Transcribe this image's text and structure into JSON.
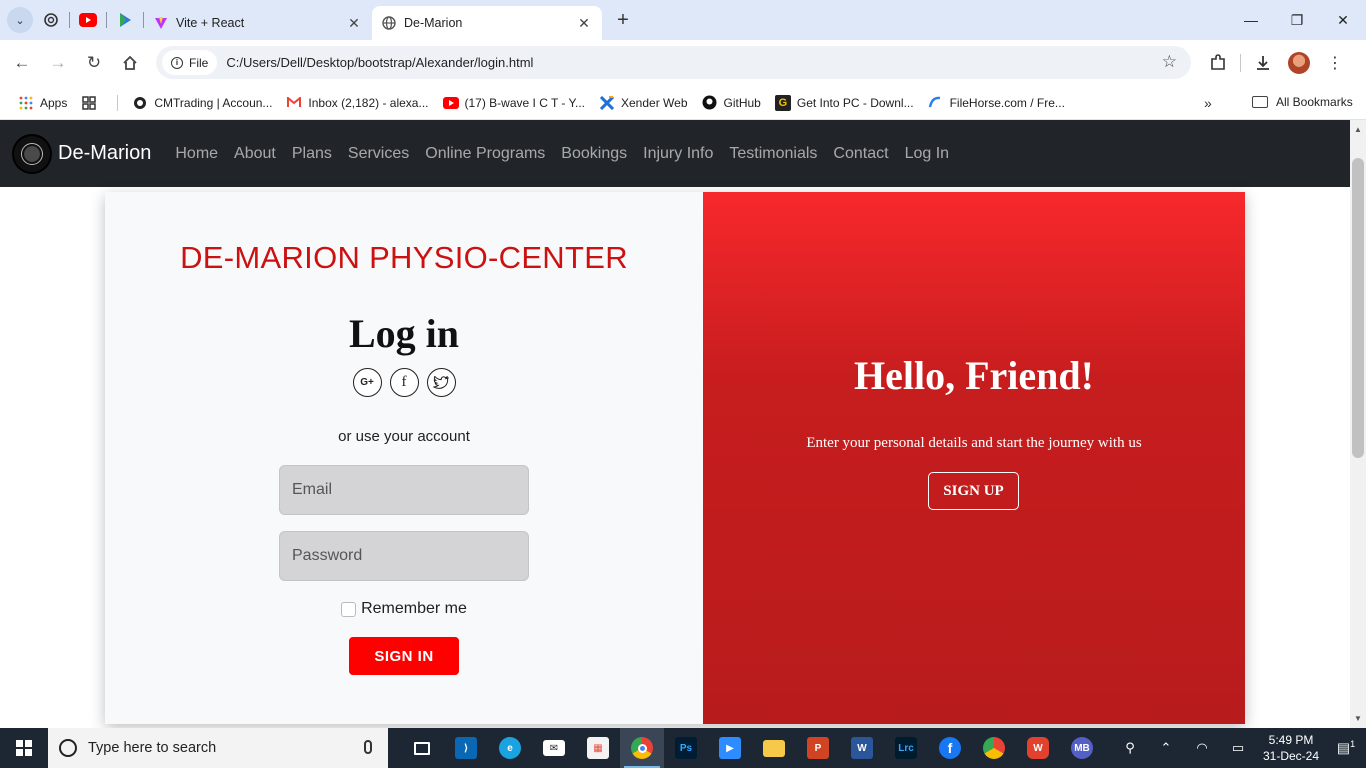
{
  "browser": {
    "tabs": [
      {
        "title": "Vite + React",
        "close": "✕"
      },
      {
        "title": "De-Marion",
        "close": "✕"
      }
    ],
    "new_tab": "+",
    "window_controls": {
      "minimize": "—",
      "restore": "❐",
      "close": "✕"
    },
    "address": {
      "chip_label": "File",
      "url": "C:/Users/Dell/Desktop/bootstrap/Alexander/login.html"
    },
    "bookmarks": [
      {
        "label": "Apps",
        "icon": "apps-grid-icon"
      },
      {
        "label": "",
        "icon": "grid-icon"
      },
      {
        "label": "CMTrading | Accoun...",
        "icon": "cmtrading-icon"
      },
      {
        "label": "Inbox (2,182) - alexa...",
        "icon": "gmail-icon"
      },
      {
        "label": "(17) B-wave I C T - Y...",
        "icon": "youtube-icon"
      },
      {
        "label": "Xender Web",
        "icon": "xender-icon"
      },
      {
        "label": "GitHub",
        "icon": "github-icon"
      },
      {
        "label": "Get Into PC - Downl...",
        "icon": "getintopc-icon"
      },
      {
        "label": "FileHorse.com / Fre...",
        "icon": "filehorse-icon"
      }
    ],
    "more_bookmarks": "»",
    "all_bookmarks": "All Bookmarks"
  },
  "site": {
    "brand": "De-Marion",
    "nav": [
      "Home",
      "About",
      "Plans",
      "Services",
      "Online Programs",
      "Bookings",
      "Injury Info",
      "Testimonials",
      "Contact",
      "Log In"
    ]
  },
  "login": {
    "center_title": "DE-MARION PHYSIO-CENTER",
    "title": "Log in",
    "socials": [
      {
        "icon": "google-plus-icon",
        "glyph": "G+"
      },
      {
        "icon": "facebook-icon",
        "glyph": "f"
      },
      {
        "icon": "twitter-icon",
        "glyph": "🐦"
      }
    ],
    "alt_text": "or use your account",
    "email_placeholder": "Email",
    "password_placeholder": "Password",
    "remember": "Remember me",
    "signin": "SIGN IN"
  },
  "panel": {
    "title": "Hello, Friend!",
    "subtitle": "Enter your personal details and start the journey with us",
    "signup": "SIGN UP"
  },
  "taskbar": {
    "search_placeholder": "Type here to search",
    "time": "5:49 PM",
    "date": "31-Dec-24",
    "notification_count": "1"
  },
  "colors": {
    "brand_red": "#cc1111",
    "signin_red": "#fd0000",
    "panel_red_top": "#f7282c",
    "panel_red_bottom": "#b81b1c",
    "navbar_dark": "#212529"
  }
}
